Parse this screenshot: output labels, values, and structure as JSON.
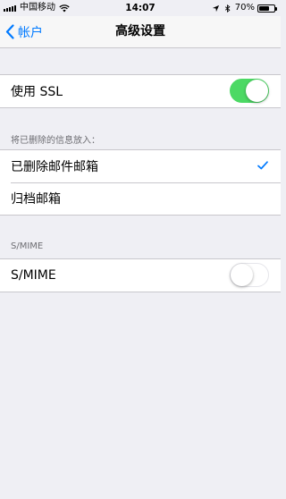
{
  "status_bar": {
    "carrier": "中国移动",
    "time": "14:07",
    "battery_percent": "70%",
    "battery_level": 0.7,
    "icons": [
      "signal-bars-icon",
      "wifi-icon",
      "location-arrow-icon",
      "bluetooth-icon",
      "battery-icon"
    ]
  },
  "nav": {
    "back_label": "帐户",
    "title": "高级设置"
  },
  "ssl": {
    "label": "使用 SSL",
    "enabled": true
  },
  "deleted_messages": {
    "header": "将已删除的信息放入：",
    "options": [
      {
        "label": "已删除邮件邮箱",
        "selected": true
      },
      {
        "label": "归档邮箱",
        "selected": false
      }
    ]
  },
  "smime": {
    "header": "S/MIME",
    "label": "S/MIME",
    "enabled": false
  },
  "colors": {
    "accent": "#007aff",
    "toggle_on": "#4cd964",
    "background": "#efeff4"
  }
}
